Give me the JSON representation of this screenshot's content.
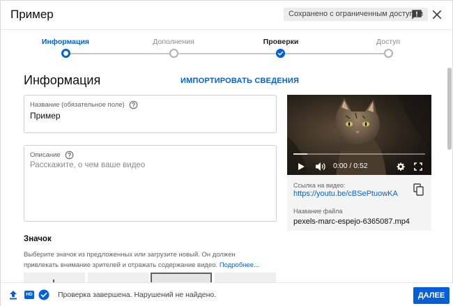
{
  "header": {
    "title": "Пример",
    "status_chip": "Сохранено с ограниченным доступом",
    "icons": [
      "feedback-icon",
      "close-icon"
    ]
  },
  "stepper": {
    "steps": [
      {
        "label": "Информация",
        "state": "active"
      },
      {
        "label": "Дополнения",
        "state": "pending"
      },
      {
        "label": "Проверки",
        "state": "done"
      },
      {
        "label": "Доступ",
        "state": "pending"
      }
    ]
  },
  "details": {
    "section_title": "Информация",
    "import_link": "ИМПОРТИРОВАТЬ СВЕДЕНИЯ",
    "title_field": {
      "label": "Название (обязательное поле)",
      "value": "Пример"
    },
    "description_field": {
      "label": "Описание",
      "placeholder": "Расскажите, о чем ваше видео"
    },
    "thumbnail": {
      "title": "Значок",
      "description": "Выберите значок из предложенных или загрузите новый. Он должен привлекать внимание зрителей и отражать содержание видео.",
      "more_link": "Подробнее..."
    }
  },
  "video": {
    "time": "0:00 / 0:52",
    "progress": 0.0,
    "link_label": "Ссылка на видео:",
    "link": "https://youtu.be/cBSePtuowKA",
    "filename_label": "Название файла",
    "filename": "pexels-marc-espejo-6365087.mp4"
  },
  "footer": {
    "hd_badge": "HD",
    "status": "Проверка завершена. Нарушений не найдено.",
    "next_button": "ДАЛЕЕ"
  },
  "colors": {
    "accent": "#065fd4",
    "chip_bg": "#ececec",
    "border": "#cfcfcf"
  }
}
